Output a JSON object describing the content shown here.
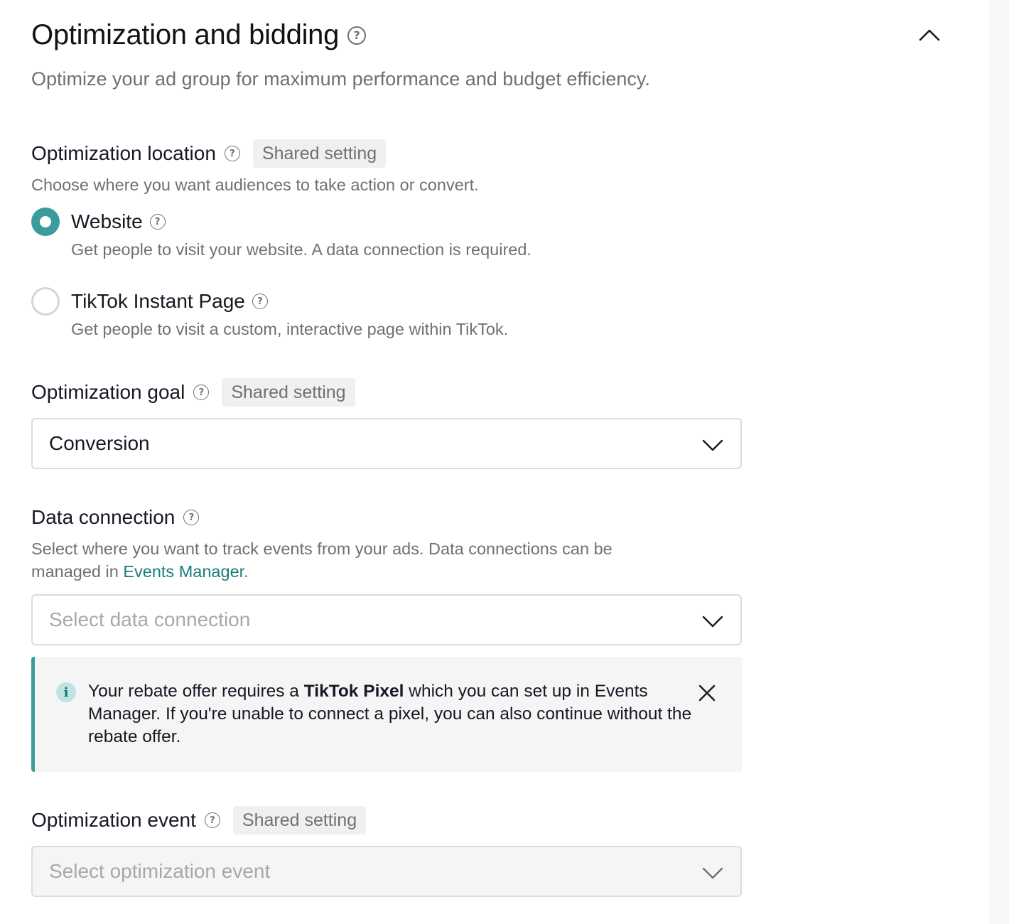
{
  "section": {
    "title": "Optimization and bidding",
    "subtitle": "Optimize your ad group for maximum performance and budget efficiency."
  },
  "icons": {
    "help": "?",
    "info": "i"
  },
  "optimization_location": {
    "label": "Optimization location",
    "badge": "Shared setting",
    "description": "Choose where you want audiences to take action or convert.",
    "options": [
      {
        "label": "Website",
        "description": "Get people to visit your website. A data connection is required.",
        "selected": true
      },
      {
        "label": "TikTok Instant Page",
        "description": "Get people to visit a custom, interactive page within TikTok.",
        "selected": false
      }
    ]
  },
  "optimization_goal": {
    "label": "Optimization goal",
    "badge": "Shared setting",
    "value": "Conversion"
  },
  "data_connection": {
    "label": "Data connection",
    "description_before": "Select where you want to track events from your ads. Data connections can be managed in ",
    "link_text": "Events Manager",
    "description_after": ".",
    "placeholder": "Select data connection"
  },
  "notice": {
    "text_before": "Your rebate offer requires a ",
    "bold": "TikTok Pixel",
    "text_after": " which you can set up in Events Manager. If you're unable to connect a pixel, you can also continue without the rebate offer."
  },
  "optimization_event": {
    "label": "Optimization event",
    "badge": "Shared setting",
    "placeholder": "Select optimization event"
  },
  "colors": {
    "accent": "#3a9c9c",
    "link": "#1b7c7c",
    "text_primary": "#161823",
    "text_secondary": "#6f7075"
  }
}
